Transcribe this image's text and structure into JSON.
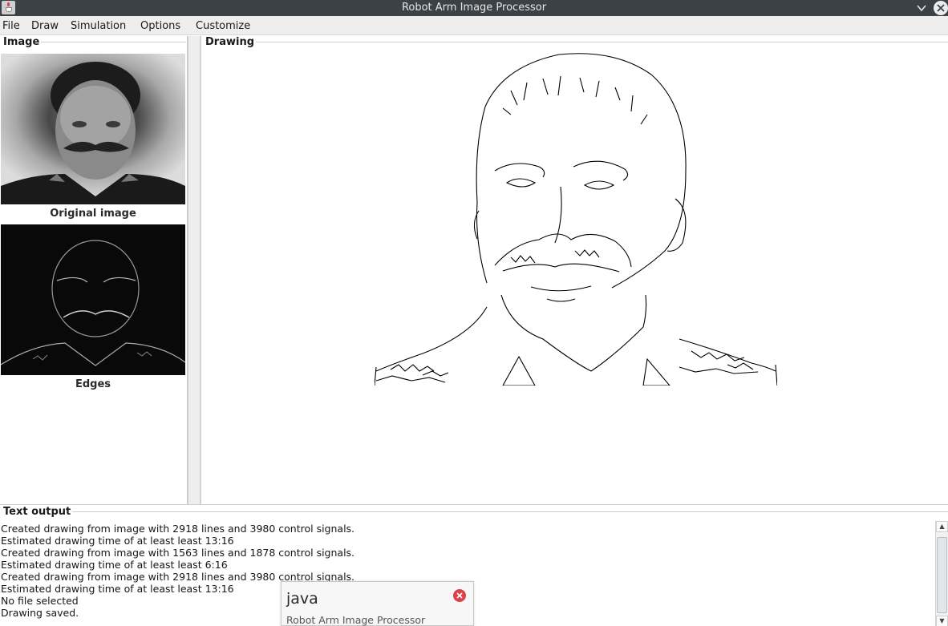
{
  "window": {
    "title": "Robot Arm Image Processor"
  },
  "menu": {
    "items": [
      "File",
      "Draw",
      "Simulation",
      "Options",
      "Customize"
    ]
  },
  "left_panel": {
    "title": "Image",
    "original_caption": "Original image",
    "edges_caption": "Edges"
  },
  "right_panel": {
    "title": "Drawing"
  },
  "text_output": {
    "title": "Text output",
    "lines": [
      "Created drawing from image with 2918 lines and 3980 control signals.",
      "Estimated drawing time of at least least 13:16",
      "Created drawing from image with 1563 lines and 1878 control signals.",
      "Estimated drawing time of at least least 6:16",
      "Created drawing from image with 2918 lines and 3980 control signals.",
      "Estimated drawing time of at least least 13:16",
      "No file selected",
      "Drawing saved."
    ]
  },
  "notification": {
    "title": "java",
    "body": "Robot Arm Image Processor"
  },
  "colors": {
    "titlebar_bg": "#3c4146",
    "menubar_bg": "#eeeeee",
    "close_red": "#d9434a"
  },
  "icons": {
    "app": "java-cup-icon",
    "minimize": "chevron-down-icon",
    "close": "close-icon",
    "scroll_up": "arrow-up-icon",
    "scroll_down": "arrow-down-icon"
  }
}
